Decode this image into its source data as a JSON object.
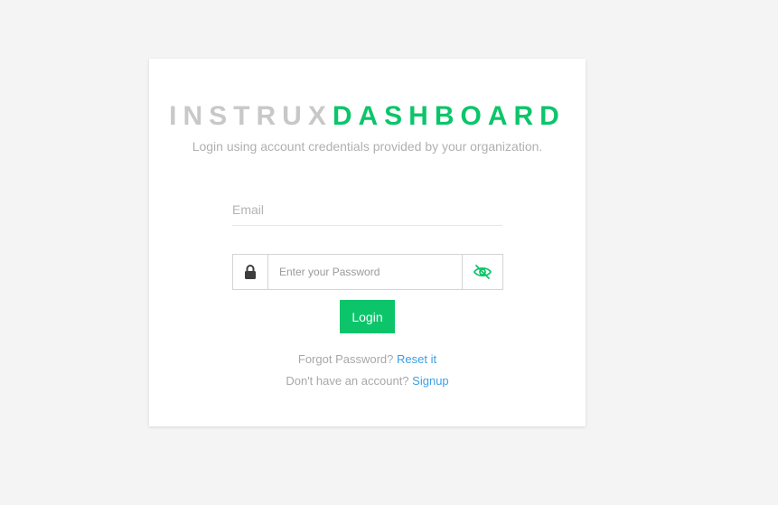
{
  "brand": {
    "part1": "INSTRUX",
    "part2": "DASHBOARD",
    "accent_color": "#0cc56a",
    "muted_color": "#c8c8c8"
  },
  "subtitle": "Login using account credentials provided by your organization.",
  "email": {
    "placeholder": "Email",
    "value": ""
  },
  "password": {
    "placeholder": "Enter your Password",
    "value": "",
    "lock_icon": "lock-icon",
    "toggle_icon": "eye-slash-icon"
  },
  "login_button": "Login",
  "forgot": {
    "text": "Forgot Password?",
    "link": "Reset it"
  },
  "signup": {
    "text": "Don't have an account?",
    "link": "Signup"
  },
  "link_color": "#3b9fe8"
}
